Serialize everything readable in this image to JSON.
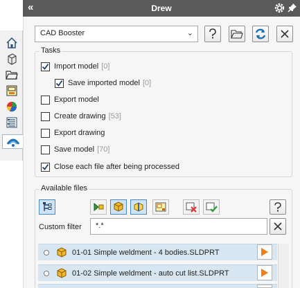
{
  "title_bar": {
    "collapse_label": "«",
    "title": "Drew"
  },
  "side_tabs": [
    {
      "icon": "home-icon"
    },
    {
      "icon": "parts-icon"
    },
    {
      "icon": "folder-icon"
    },
    {
      "icon": "drawing-icon"
    },
    {
      "icon": "appearance-icon"
    },
    {
      "icon": "properties-icon"
    },
    {
      "icon": "drew-icon",
      "active": true
    }
  ],
  "toolbar": {
    "profile_selected": "CAD Booster",
    "help_icon": "help-icon",
    "open_folder_icon": "folder-icon",
    "refresh_icon": "refresh-icon",
    "close_icon": "close-icon"
  },
  "tasks": {
    "title": "Tasks",
    "items": [
      {
        "label": "Import model",
        "count": "[0]",
        "checked": true
      },
      {
        "label": "Save imported model",
        "count": "[0]",
        "checked": true
      },
      {
        "label": "Export model",
        "count": "",
        "checked": false
      },
      {
        "label": "Create drawing",
        "count": "[53]",
        "checked": false
      },
      {
        "label": "Export drawing",
        "count": "",
        "checked": false
      },
      {
        "label": "Save model",
        "count": "[70]",
        "checked": false
      },
      {
        "label": "Close each file after being processed",
        "count": "",
        "checked": true
      }
    ]
  },
  "available_files": {
    "title": "Available files",
    "filter_label": "Custom filter",
    "filter_value": "*.*",
    "files": [
      {
        "name": "01-01 Simple weldment - 4 bodies.SLDPRT"
      },
      {
        "name": "01-02 Simple weldment - auto cut list.SLDPRT"
      }
    ]
  },
  "colors": {
    "title_bar": "#5a5a5a",
    "accent_blue": "#1f6fb4",
    "row_highlight": "#d7e6f0",
    "play_orange": "#f07d1a"
  }
}
